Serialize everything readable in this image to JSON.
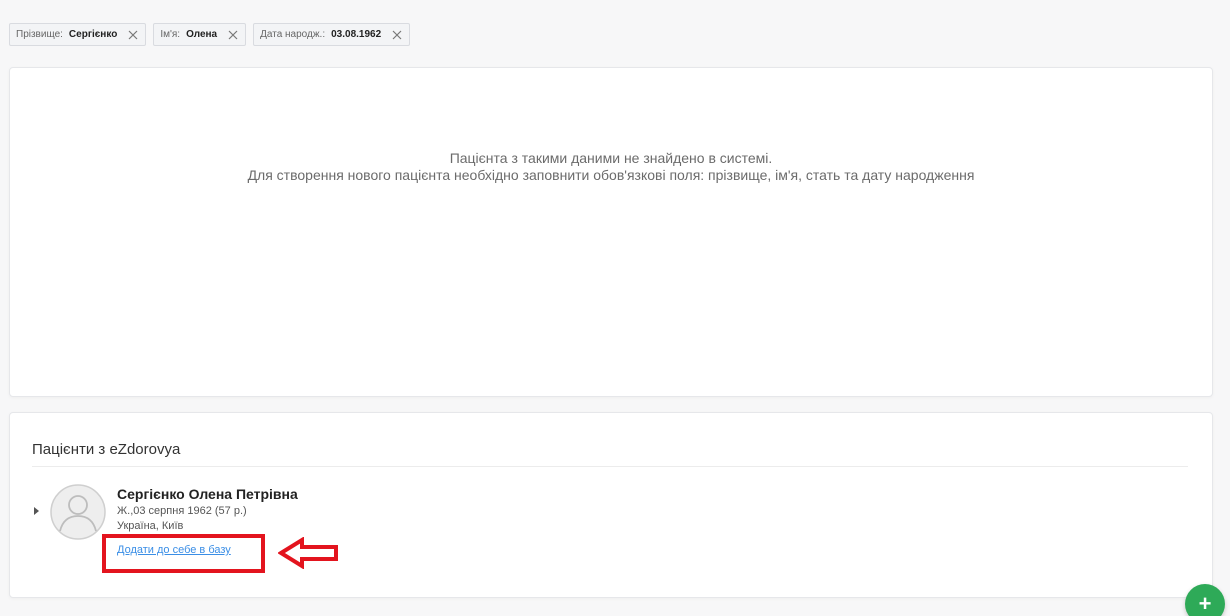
{
  "filters": [
    {
      "label": "Прізвище:",
      "value": "Сергієнко"
    },
    {
      "label": "Ім'я:",
      "value": "Олена"
    },
    {
      "label": "Дата народж.:",
      "value": "03.08.1962"
    }
  ],
  "empty_state": {
    "line1": "Пацієнта з такими даними не знайдено в системі.",
    "line2": "Для створення нового пацієнта необхідно заповнити обов'язкові поля: прізвище, ім'я, стать та дату народження"
  },
  "ezdorovya": {
    "title": "Пацієнти з eZdorovya",
    "patient": {
      "name": "Сергієнко Олена Петрівна",
      "dob": "Ж.,03 серпня 1962 (57 р.)",
      "location": "Україна, Київ",
      "add_link": "Додати до себе в базу"
    }
  },
  "fab": {
    "icon": "plus-icon",
    "label": "+"
  },
  "colors": {
    "highlight": "#e3141e",
    "link": "#3a8ee6",
    "fab": "#2eaa58"
  }
}
